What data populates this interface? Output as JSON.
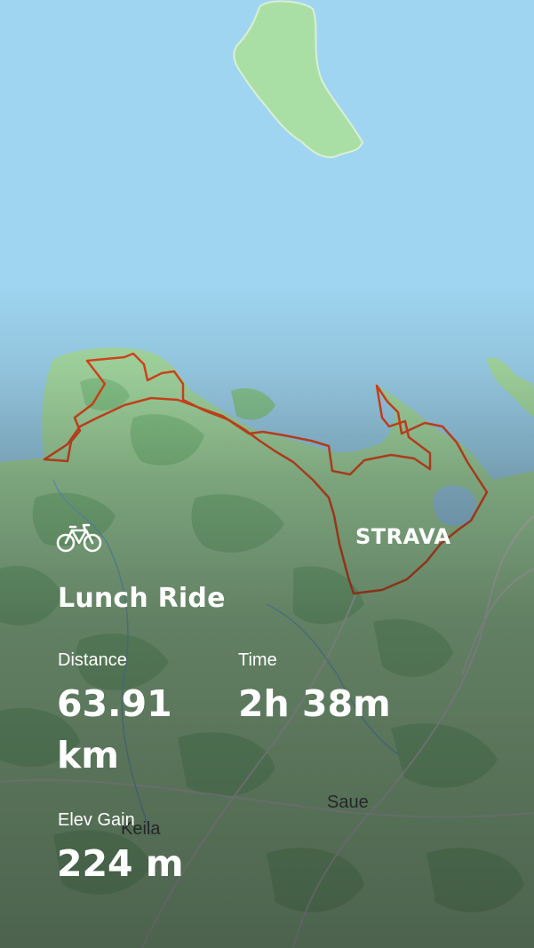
{
  "map": {
    "place_labels": [
      "Saue",
      "Keila"
    ],
    "colors": {
      "water": "#9fd5f0",
      "land": "#a9dfa4",
      "forest": "#7fc77f",
      "route": "#e0461a"
    }
  },
  "activity": {
    "sport_icon": "bicycle-icon",
    "title": "Lunch Ride",
    "brand": "STRAVA",
    "stats": {
      "distance_label": "Distance",
      "distance_value": "63.91 km",
      "time_label": "Time",
      "time_value": "2h 38m",
      "elev_label": "Elev Gain",
      "elev_value": "224 m"
    }
  }
}
